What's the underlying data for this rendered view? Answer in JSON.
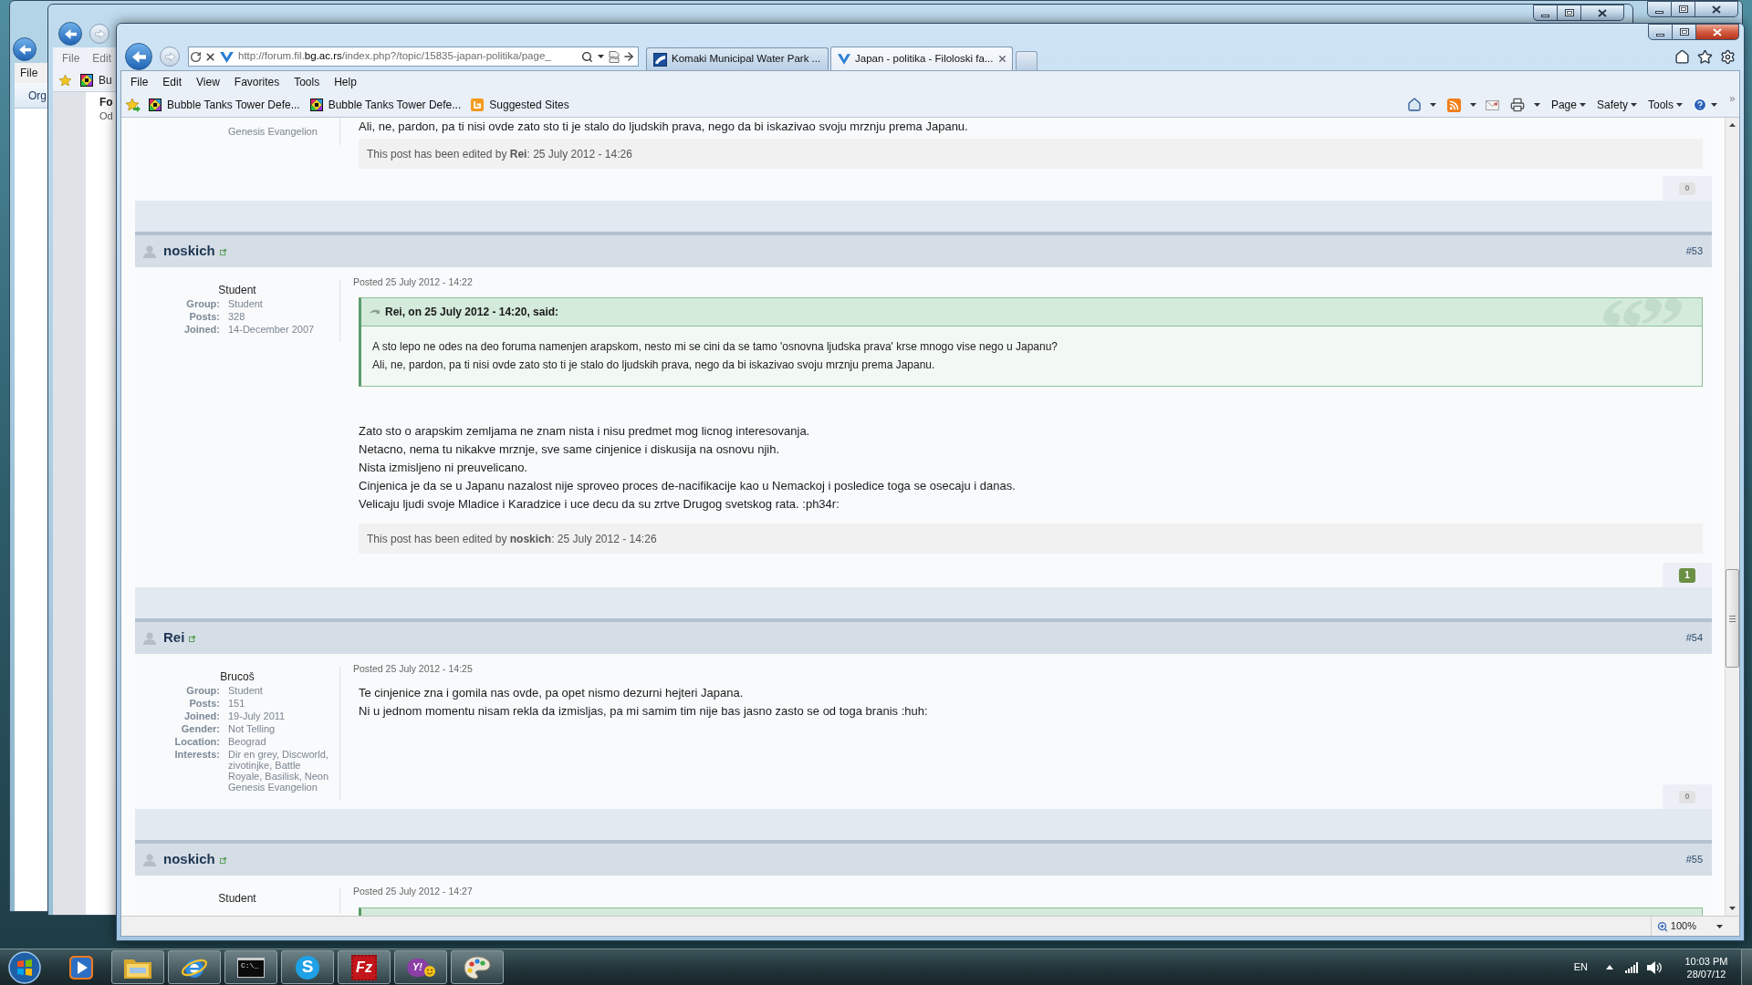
{
  "background_windows": [
    {
      "active": false,
      "menu": [
        "File"
      ],
      "toolbar": [
        "Org"
      ]
    },
    {
      "active": false,
      "menu": [
        "File",
        "Edit"
      ],
      "favorites": [
        "Bu"
      ],
      "page": [
        "Fo",
        "Od"
      ]
    }
  ],
  "browser": {
    "active": true,
    "address": {
      "start": "http://forum.fil.",
      "domain": "bg.ac.rs",
      "rest": "/index.php?/topic/15835-japan-politika/page_"
    },
    "tabs": [
      {
        "title": "Komaki Municipal Water Park ...",
        "selected": false
      },
      {
        "title": "Japan - politika - Filoloski fa...",
        "selected": true
      }
    ],
    "menu": [
      "File",
      "Edit",
      "View",
      "Favorites",
      "Tools",
      "Help"
    ],
    "favorites": [
      {
        "kind": "bookmark",
        "label": "Bubble Tanks Tower Defe..."
      },
      {
        "kind": "bookmark",
        "label": "Bubble Tanks Tower Defe..."
      },
      {
        "kind": "suggested",
        "label": "Suggested Sites"
      }
    ],
    "command_bar": [
      "Page",
      "Safety",
      "Tools"
    ],
    "zoom": "100%"
  },
  "posts": [
    {
      "kind": "tail",
      "author_tail": "Genesis Evangelion",
      "body": [
        "Ali, ne, pardon, pa ti nisi ovde zato sto ti je stalo do ljudskih prava, nego da bi iskazivao svoju mrznju prema Japanu."
      ],
      "edit_note": "This post has been edited by **Rei**: 25 July 2012 - 14:26",
      "reputation": {
        "count": "0",
        "positive": false
      }
    },
    {
      "kind": "full",
      "author": "noskich",
      "number": "#53",
      "rank": "Student",
      "fields": [
        {
          "label": "Group:",
          "value": "Student"
        },
        {
          "label": "Posts:",
          "value": "328"
        },
        {
          "label": "Joined:",
          "value": "14-December 2007"
        }
      ],
      "posted": "Posted 25 July 2012 - 14:22",
      "quote": {
        "header": "Rei, on 25 July 2012 - 14:20, said:",
        "lines": [
          "A sto lepo ne odes na deo foruma namenjen arapskom, nesto mi se cini da se tamo 'osnovna ljudska prava' krse mnogo vise nego u Japanu?",
          "Ali, ne, pardon, pa ti nisi ovde zato sto ti je stalo do ljudskih prava, nego da bi iskazivao svoju mrznju prema Japanu."
        ]
      },
      "body": [
        "Zato sto o arapskim zemljama ne znam nista i nisu predmet mog licnog interesovanja.",
        "Netacno, nema tu nikakve mrznje, sve same cinjenice i diskusija na osnovu njih.",
        "Nista izmisljeno ni preuvelicano.",
        "Cinjenica je da se u Japanu nazalost nije sproveo proces de-nacifikacije kao u Nemackoj i posledice toga se osecaju i danas.",
        "Velicaju ljudi svoje Mladice i Karadzice i uce decu da su zrtve Drugog svetskog rata. :ph34r:"
      ],
      "edit_note": "This post has been edited by **noskich**: 25 July 2012 - 14:26",
      "reputation": {
        "count": "1",
        "positive": true
      }
    },
    {
      "kind": "full",
      "author": "Rei",
      "number": "#54",
      "rank": "Brucoš",
      "fields": [
        {
          "label": "Group:",
          "value": "Student"
        },
        {
          "label": "Posts:",
          "value": "151"
        },
        {
          "label": "Joined:",
          "value": "19-July 2011"
        },
        {
          "label": "Gender:",
          "value": "Not Telling"
        },
        {
          "label": "Location:",
          "value": "Beograd"
        },
        {
          "label": "Interests:",
          "value": "Dir en grey, Discworld, zivotinjke, Battle Royale, Basilisk, Neon Genesis Evangelion"
        }
      ],
      "posted": "Posted 25 July 2012 - 14:25",
      "body": [
        "Te cinjenice zna i gomila nas ovde, pa opet nismo dezurni hejteri Japana.",
        "Ni u jednom momentu nisam rekla da izmisljas, pa mi samim tim nije bas jasno zasto se od toga branis :huh:"
      ],
      "reputation": {
        "count": "0",
        "positive": false
      }
    },
    {
      "kind": "head",
      "author": "noskich",
      "number": "#55",
      "rank": "Student",
      "posted": "Posted 25 July 2012 - 14:27",
      "quote_visible": true
    }
  ],
  "taskbar": {
    "apps": [
      {
        "running": false
      },
      {
        "running": true
      },
      {
        "running": true
      },
      {
        "running": true,
        "glyph": "C:\\_"
      },
      {
        "running": true,
        "glyph": "S"
      },
      {
        "running": true,
        "glyph": "Fz"
      },
      {
        "running": true,
        "glyph": "Y!"
      },
      {
        "running": true
      }
    ],
    "language": "EN",
    "time": "10:03 PM",
    "date": "28/07/12"
  }
}
